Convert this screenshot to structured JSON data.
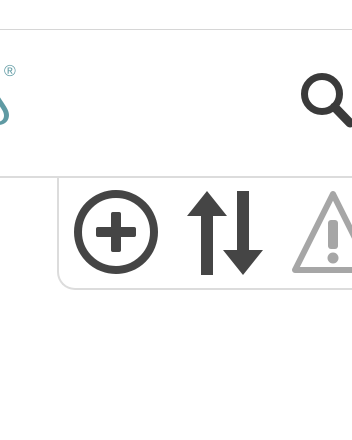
{
  "header": {
    "logo": {
      "registered_mark": "®",
      "icon": "brand-drop-icon",
      "color": "#5f9aa3"
    },
    "search": {
      "icon": "search-icon",
      "color": "#3a3a3a"
    }
  },
  "toolbar": {
    "buttons": [
      {
        "icon": "add-circle-icon",
        "color": "#454545"
      },
      {
        "icon": "sort-arrows-icon",
        "color": "#454545"
      },
      {
        "icon": "warning-icon",
        "color": "#a6a6a6"
      }
    ]
  }
}
